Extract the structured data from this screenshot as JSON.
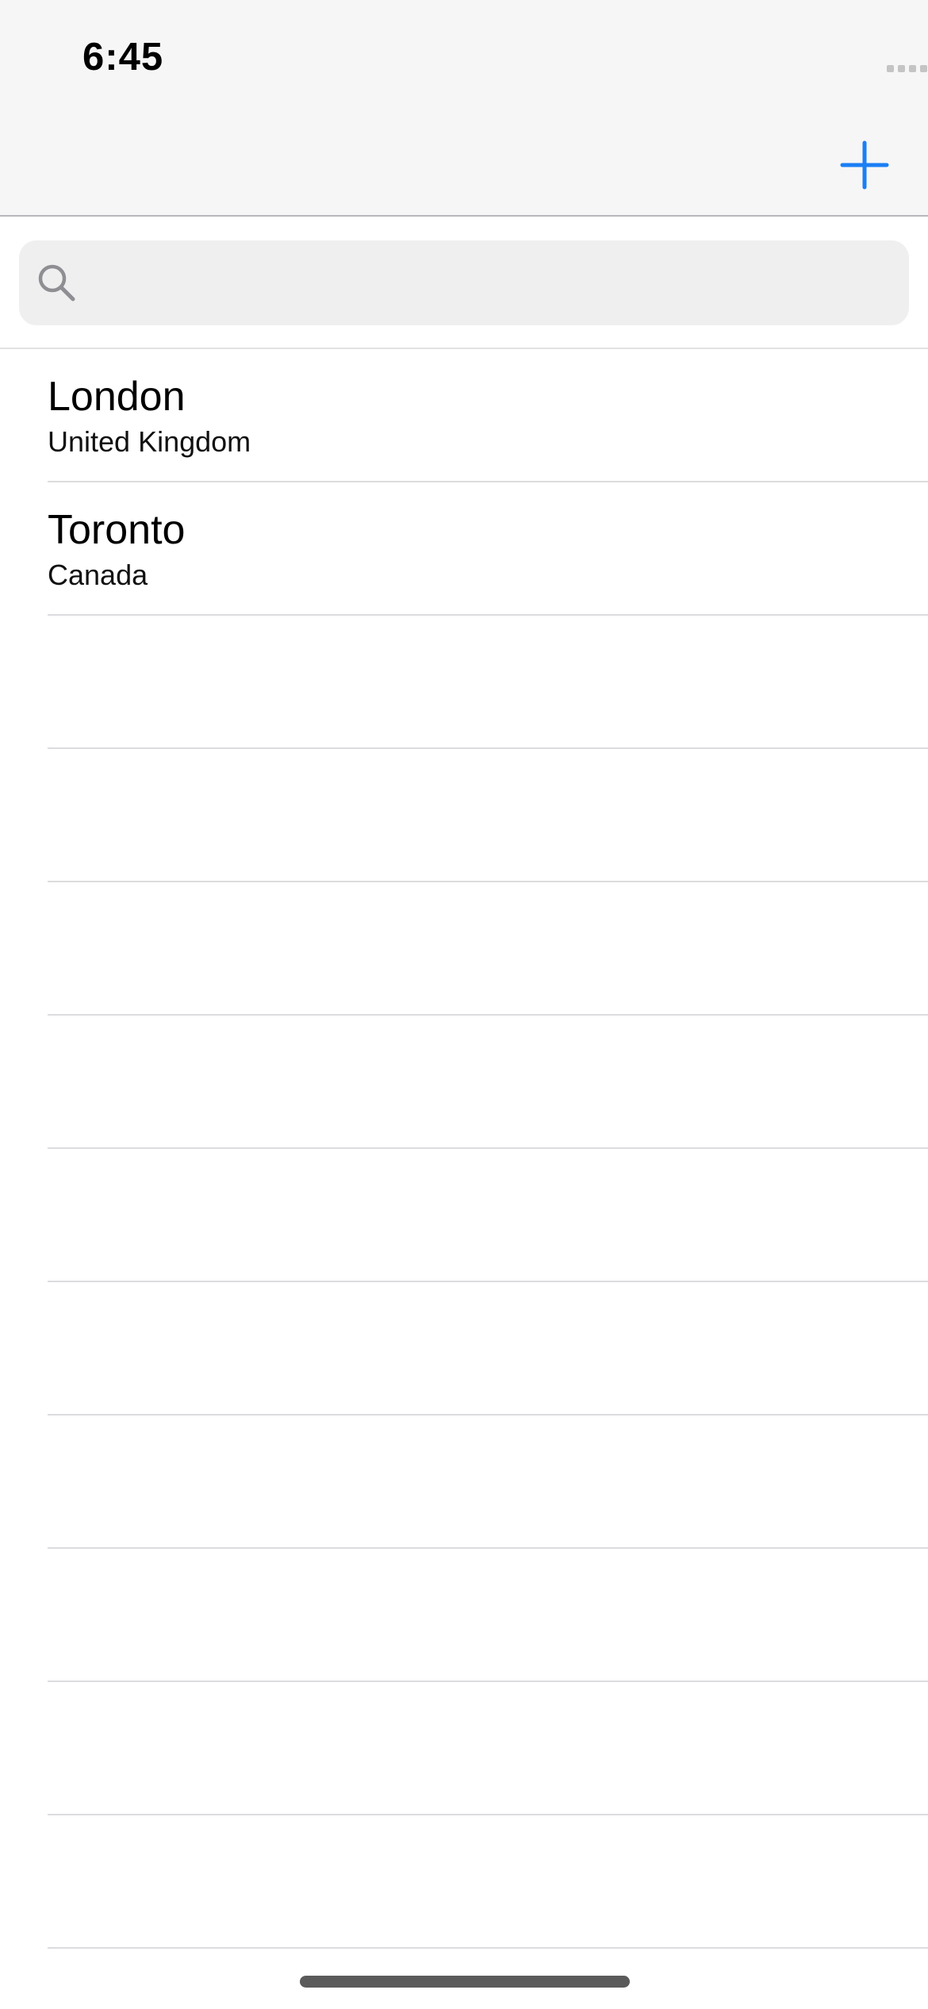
{
  "status_bar": {
    "time": "6:45"
  },
  "nav_bar": {
    "add_button_icon": "plus-icon",
    "accent_color": "#1a7ff5"
  },
  "search": {
    "icon": "search-icon",
    "placeholder": "",
    "value": ""
  },
  "cities": [
    {
      "name": "London",
      "country": "United Kingdom"
    },
    {
      "name": "Toronto",
      "country": "Canada"
    }
  ],
  "empty_row_count": 10
}
